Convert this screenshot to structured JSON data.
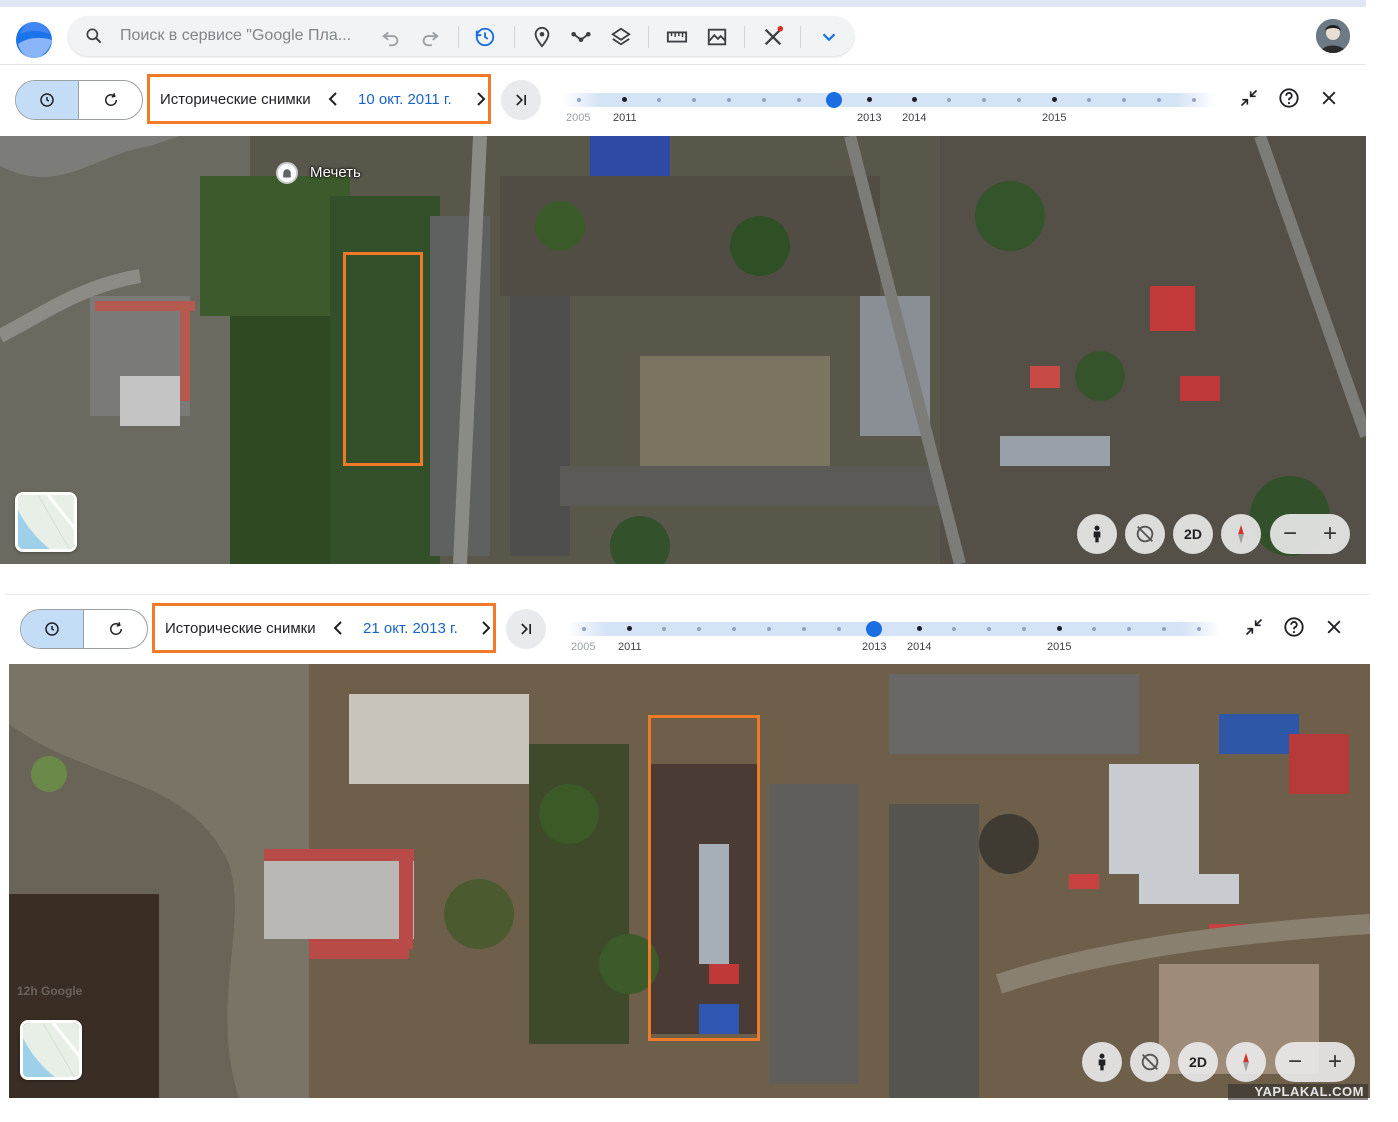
{
  "app": {
    "search_placeholder": "Поиск в сервисе \"Google Пла...",
    "colors": {
      "accent": "#1a6ee0",
      "highlight": "#f07a27",
      "segment_active": "#c4ddf7"
    },
    "toolbar_icons": [
      "undo-icon",
      "redo-icon",
      "historical-imagery-icon",
      "place-marker-icon",
      "path-icon",
      "layers-icon",
      "measure-icon",
      "image-overlay-icon",
      "projects-icon",
      "expand-chevron-icon"
    ]
  },
  "panels": [
    {
      "label": "Исторические снимки",
      "date": "10 окт. 2011 г.",
      "timeline_labels": [
        "2005",
        "2011",
        "2013",
        "2014",
        "2015"
      ],
      "map_label": "Мечеть",
      "controls": {
        "view_2d": "2D",
        "zoom_out": "−",
        "zoom_in": "+"
      }
    },
    {
      "label": "Исторические снимки",
      "date": "21 окт. 2013 г.",
      "timeline_labels": [
        "2005",
        "2011",
        "2013",
        "2014",
        "2015"
      ],
      "watermark": "12h Google",
      "controls": {
        "view_2d": "2D",
        "zoom_out": "−",
        "zoom_in": "+"
      }
    }
  ],
  "site_watermark": "YAPLAKAL.COM"
}
